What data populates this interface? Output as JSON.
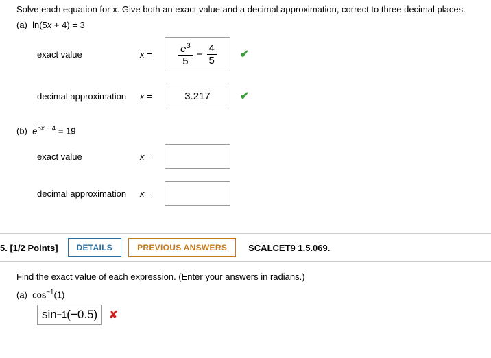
{
  "q4": {
    "instruction": "Solve each equation for x. Give both an exact value and a decimal approximation, correct to three decimal places.",
    "partA": {
      "label": "(a)",
      "equation_html": "ln(5x + 4) = 3",
      "exact_label": "exact value",
      "exact_lhs": "x =",
      "exact_frac1_num": "e",
      "exact_frac1_num_sup": "3",
      "exact_frac1_den": "5",
      "exact_minus": "−",
      "exact_frac2_num": "4",
      "exact_frac2_den": "5",
      "decimal_label": "decimal approximation",
      "decimal_lhs": "x =",
      "decimal_value": "3.217"
    },
    "partB": {
      "label": "(b)",
      "equation_base": "e",
      "equation_exp": "5x − 4",
      "equation_tail": " = 19",
      "exact_label": "exact value",
      "exact_lhs": "x =",
      "decimal_label": "decimal approximation",
      "decimal_lhs": "x ="
    }
  },
  "q5": {
    "points": "5. [1/2 Points]",
    "details_btn": "DETAILS",
    "prev_btn": "PREVIOUS ANSWERS",
    "reference": "SCALCET9 1.5.069.",
    "instruction": "Find the exact value of each expression. (Enter your answers in radians.)",
    "partA": {
      "label": "(a)",
      "expr_pre": "cos",
      "expr_sup": "−1",
      "expr_arg": "(1)",
      "ans_pre": "sin",
      "ans_sup": "−1",
      "ans_arg": "(−0.5)"
    }
  }
}
